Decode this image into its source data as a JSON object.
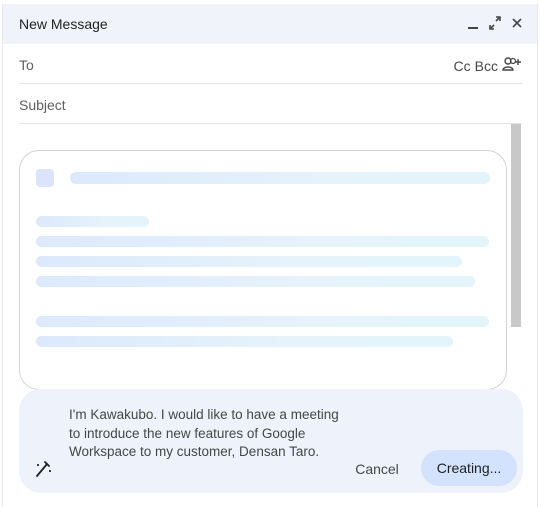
{
  "header": {
    "title": "New Message",
    "icons": [
      "minimize-icon",
      "expand-icon",
      "close-icon"
    ]
  },
  "recipients": {
    "to_label": "To",
    "cc_label": "Cc",
    "bcc_label": "Bcc",
    "add_recipients_icon": "add-people-icon"
  },
  "subject": {
    "placeholder": "Subject"
  },
  "composer": {
    "prompt_text": "I'm Kawakubo. I would like to have a meeting to introduce the new features of Google Workspace to my customer, Densan Taro.",
    "cancel_label": "Cancel",
    "creating_label": "Creating...",
    "wand_icon": "magic-wand-icon"
  },
  "colors": {
    "header_bg": "#f0f4fa",
    "composer_bg": "#eef2fa",
    "button_bg": "#d3e3fd",
    "skeleton": "#dbe9fb"
  }
}
